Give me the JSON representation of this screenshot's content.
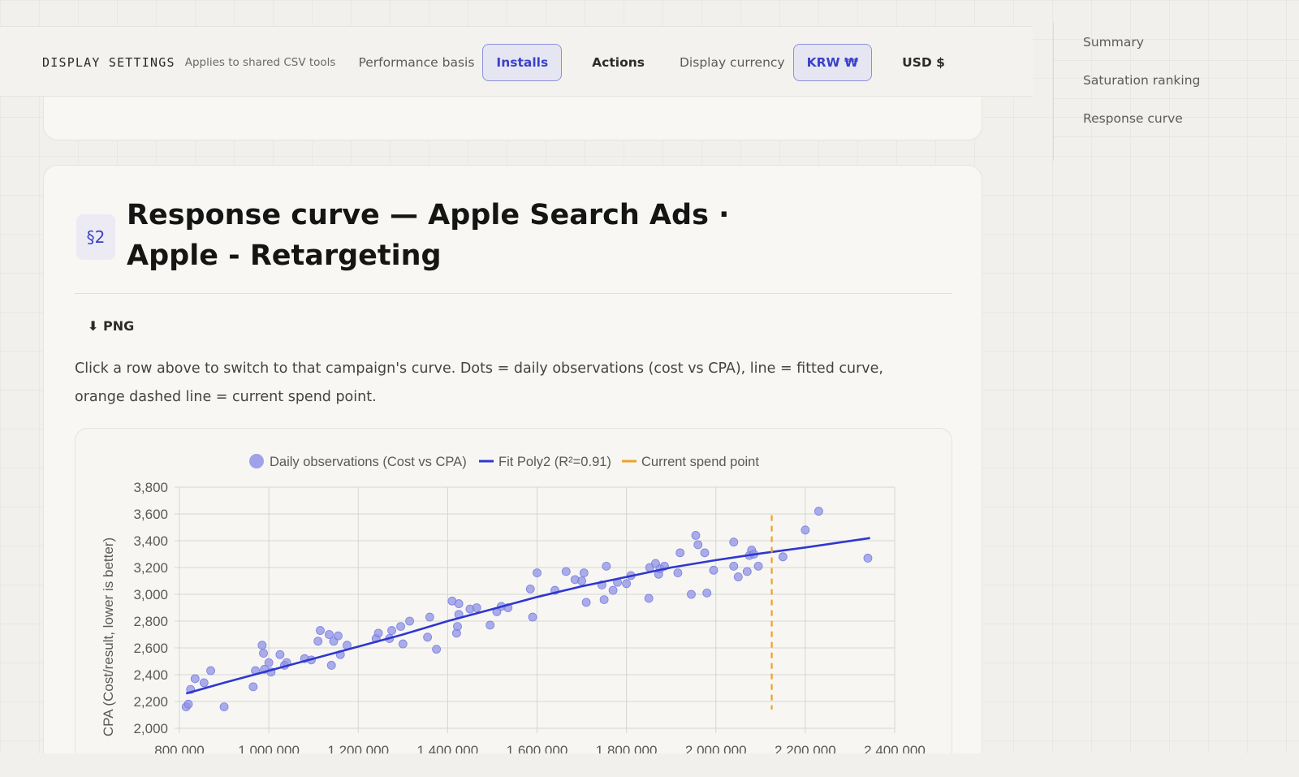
{
  "settings": {
    "title": "DISPLAY SETTINGS",
    "subtitle": "Applies to shared CSV tools",
    "basis_label": "Performance basis",
    "basis_options": [
      "Installs",
      "Actions"
    ],
    "basis_selected": "Installs",
    "currency_label": "Display currency",
    "currency_options": [
      "KRW ₩",
      "USD $"
    ],
    "currency_selected": "KRW ₩"
  },
  "nav": {
    "items": [
      "Summary",
      "Saturation ranking",
      "Response curve"
    ]
  },
  "section": {
    "badge": "§2",
    "title": "Response curve — Apple Search Ads · Apple - Retargeting",
    "png_label": "⬇ PNG",
    "description": "Click a row above to switch to that campaign's curve. Dots = daily observations (cost vs CPA), line = fitted curve, orange dashed line = current spend point."
  },
  "colors": {
    "accent": "#3b41c7",
    "dots": "#8f93e6",
    "fit": "#2f37cf",
    "current": "#f0a024"
  },
  "chart_data": {
    "type": "scatter",
    "ylabel": "CPA (Cost/result, lower is better)",
    "xlabel": "",
    "xlim": [
      800000,
      2400000
    ],
    "ylim": [
      2000,
      3800
    ],
    "x_ticks": [
      800000,
      1000000,
      1200000,
      1400000,
      1600000,
      1800000,
      2000000,
      2200000,
      2400000
    ],
    "y_ticks": [
      2000,
      2200,
      2400,
      2600,
      2800,
      3000,
      3200,
      3400,
      3600,
      3800
    ],
    "x_tick_labels": [
      "800,000",
      "1,000,000",
      "1,200,000",
      "1,400,000",
      "1,600,000",
      "1,800,000",
      "2,000,000",
      "2,200,000",
      "2,400,000"
    ],
    "y_tick_labels": [
      "2,000",
      "2,200",
      "2,400",
      "2,600",
      "2,800",
      "3,000",
      "3,200",
      "3,400",
      "3,600",
      "3,800"
    ],
    "grid": true,
    "legend_position": "top-center",
    "legend": [
      "Daily observations (Cost vs CPA)",
      "Fit Poly2 (R²=0.91)",
      "Current spend point"
    ],
    "observations": [
      [
        815000,
        2160
      ],
      [
        820000,
        2180
      ],
      [
        825000,
        2290
      ],
      [
        835000,
        2370
      ],
      [
        855000,
        2340
      ],
      [
        870000,
        2430
      ],
      [
        900000,
        2160
      ],
      [
        965000,
        2310
      ],
      [
        970000,
        2430
      ],
      [
        985000,
        2620
      ],
      [
        988000,
        2560
      ],
      [
        990000,
        2440
      ],
      [
        1000000,
        2490
      ],
      [
        1005000,
        2420
      ],
      [
        1025000,
        2550
      ],
      [
        1035000,
        2470
      ],
      [
        1040000,
        2490
      ],
      [
        1080000,
        2520
      ],
      [
        1095000,
        2510
      ],
      [
        1110000,
        2650
      ],
      [
        1115000,
        2730
      ],
      [
        1135000,
        2700
      ],
      [
        1140000,
        2470
      ],
      [
        1145000,
        2650
      ],
      [
        1155000,
        2690
      ],
      [
        1160000,
        2550
      ],
      [
        1175000,
        2620
      ],
      [
        1240000,
        2670
      ],
      [
        1245000,
        2710
      ],
      [
        1270000,
        2670
      ],
      [
        1275000,
        2730
      ],
      [
        1295000,
        2760
      ],
      [
        1300000,
        2630
      ],
      [
        1315000,
        2800
      ],
      [
        1355000,
        2680
      ],
      [
        1360000,
        2830
      ],
      [
        1375000,
        2590
      ],
      [
        1410000,
        2950
      ],
      [
        1420000,
        2710
      ],
      [
        1422000,
        2760
      ],
      [
        1425000,
        2930
      ],
      [
        1425000,
        2850
      ],
      [
        1450000,
        2890
      ],
      [
        1465000,
        2900
      ],
      [
        1495000,
        2770
      ],
      [
        1510000,
        2870
      ],
      [
        1520000,
        2910
      ],
      [
        1535000,
        2900
      ],
      [
        1585000,
        3040
      ],
      [
        1590000,
        2830
      ],
      [
        1600000,
        3160
      ],
      [
        1640000,
        3030
      ],
      [
        1665000,
        3170
      ],
      [
        1685000,
        3110
      ],
      [
        1700000,
        3100
      ],
      [
        1705000,
        3160
      ],
      [
        1710000,
        2940
      ],
      [
        1745000,
        3070
      ],
      [
        1750000,
        2960
      ],
      [
        1755000,
        3210
      ],
      [
        1770000,
        3030
      ],
      [
        1780000,
        3090
      ],
      [
        1800000,
        3080
      ],
      [
        1810000,
        3140
      ],
      [
        1850000,
        2970
      ],
      [
        1852000,
        3200
      ],
      [
        1865000,
        3230
      ],
      [
        1872000,
        3150
      ],
      [
        1875000,
        3190
      ],
      [
        1885000,
        3210
      ],
      [
        1915000,
        3160
      ],
      [
        1920000,
        3310
      ],
      [
        1945000,
        3000
      ],
      [
        1955000,
        3440
      ],
      [
        1960000,
        3370
      ],
      [
        1975000,
        3310
      ],
      [
        1980000,
        3010
      ],
      [
        1995000,
        3180
      ],
      [
        2040000,
        3390
      ],
      [
        2040000,
        3210
      ],
      [
        2050000,
        3130
      ],
      [
        2070000,
        3170
      ],
      [
        2075000,
        3290
      ],
      [
        2080000,
        3330
      ],
      [
        2085000,
        3300
      ],
      [
        2095000,
        3210
      ],
      [
        2150000,
        3280
      ],
      [
        2200000,
        3480
      ],
      [
        2230000,
        3620
      ],
      [
        2340000,
        3270
      ]
    ],
    "fit": {
      "name": "Fit Poly2 (R²=0.91)",
      "points": [
        [
          815000,
          2260
        ],
        [
          900000,
          2340
        ],
        [
          1000000,
          2430
        ],
        [
          1100000,
          2520
        ],
        [
          1200000,
          2610
        ],
        [
          1300000,
          2700
        ],
        [
          1400000,
          2800
        ],
        [
          1500000,
          2890
        ],
        [
          1600000,
          2980
        ],
        [
          1700000,
          3060
        ],
        [
          1800000,
          3130
        ],
        [
          1900000,
          3200
        ],
        [
          2000000,
          3255
        ],
        [
          2100000,
          3305
        ],
        [
          2200000,
          3350
        ],
        [
          2345000,
          3420
        ]
      ]
    },
    "current_spend": 2125000
  }
}
